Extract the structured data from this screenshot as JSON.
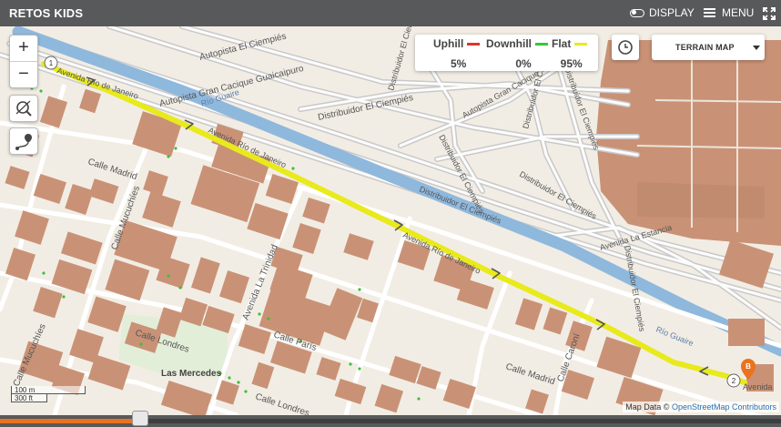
{
  "header": {
    "title": "RETOS KIDS",
    "display_label": "DISPLAY",
    "menu_label": "MENU"
  },
  "stats": {
    "uphill": {
      "label": "Uphill",
      "value": "5%",
      "color": "#e0342c"
    },
    "downhill": {
      "label": "Downhill",
      "value": "0%",
      "color": "#39c53c"
    },
    "flat": {
      "label": "Flat",
      "value": "95%",
      "color": "#e8ea1c"
    }
  },
  "map_type": {
    "label": "TERRAIN MAP"
  },
  "markers": {
    "start": "1",
    "end": "2",
    "end_badge": "B"
  },
  "labels": {
    "autopista_top": "Autopista El Ciempiés",
    "gran_cacique": "Autopista Gran Cacique Guaicaipuro",
    "distribuidor_1": "Distribuidor El Ciempiés",
    "distribuidor_2": "Distribuidor El Ciempiés",
    "distribuidor_3": "Distribuidor El Ciempiés",
    "distribuidor_4": "Distribuidor El Ciempiés",
    "distribuidor_5": "Distribuidor El Ciempiés",
    "distribuidor_6": "Distribuidor El Ciempiés",
    "autopista_gran_cacique_2": "Autopista Gran Cacique",
    "rio_guaire_1": "Río Guaire",
    "rio_guaire_2": "Río Guaire",
    "av_rio_janeiro_1": "Avenida Río de Janeiro",
    "av_rio_janeiro_2": "Avenida Río de Janeiro",
    "av_rio_janeiro_3": "Avenida Río de Janeiro",
    "av_rio_janeiro_4": "Avenida Río de Janeiro",
    "calle_madrid_1": "Calle Madrid",
    "calle_madrid_2": "Calle Madrid",
    "calle_mucuchies_1": "Calle Mucuchíes",
    "calle_mucuchies_2": "Calle Mucuchíes",
    "av_la_trinidad": "Avenida La Trinidad",
    "calle_paris": "Calle París",
    "calle_londres_1": "Calle Londres",
    "calle_londres_2": "Calle Londres",
    "las_mercedes": "Las Mercedes",
    "calle_caroni": "Calle Caroní",
    "av_la_estancia": "Avenida La Estancia",
    "av_end": "Avenida"
  },
  "scale": {
    "metric": "100 m",
    "imperial": "300 ft"
  },
  "attribution": {
    "prefix": "Map Data ©",
    "link": "OpenStreetMap Contributors"
  },
  "timeline": {
    "progress": 0.18
  },
  "colors": {
    "header": "#58595b",
    "route": "#e8ea1c",
    "river": "#8fb8dd",
    "building": "#c99276",
    "ground": "#f2ede4",
    "accent": "#e9731f"
  }
}
